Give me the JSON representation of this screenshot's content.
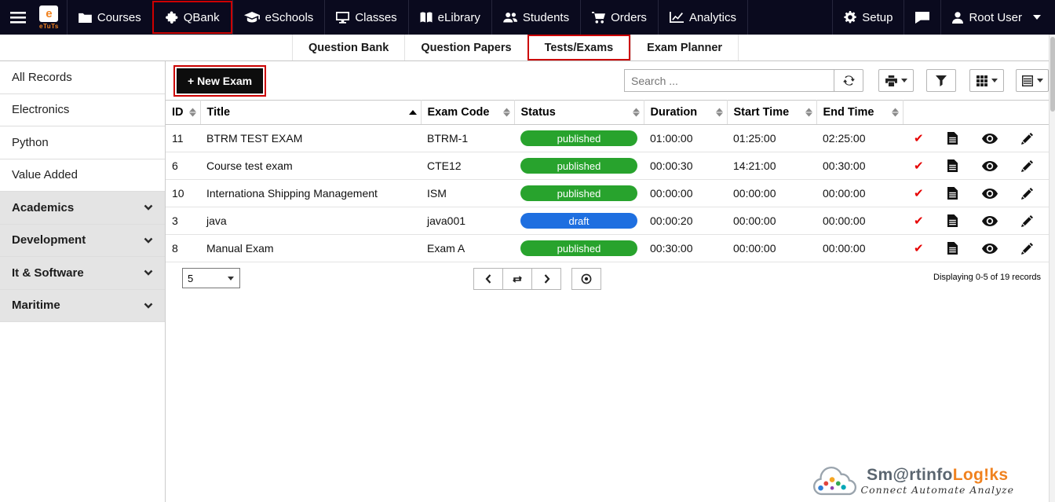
{
  "topbar": {
    "brand": {
      "logo_letter": "e",
      "name": "eTuTs"
    },
    "items": [
      {
        "label": "Courses",
        "icon": "folder"
      },
      {
        "label": "QBank",
        "icon": "puzzle",
        "active": true
      },
      {
        "label": "eSchools",
        "icon": "graduation-cap"
      },
      {
        "label": "Classes",
        "icon": "monitor"
      },
      {
        "label": "eLibrary",
        "icon": "book"
      },
      {
        "label": "Students",
        "icon": "users"
      },
      {
        "label": "Orders",
        "icon": "cart"
      },
      {
        "label": "Analytics",
        "icon": "line-chart"
      }
    ],
    "setup_label": "Setup",
    "user_label": "Root User"
  },
  "subnav": {
    "tabs": [
      {
        "label": "Question Bank"
      },
      {
        "label": "Question Papers"
      },
      {
        "label": "Tests/Exams",
        "active": true
      },
      {
        "label": "Exam Planner"
      }
    ]
  },
  "sidebar": {
    "items": [
      {
        "label": "All Records",
        "type": "link"
      },
      {
        "label": "Electronics",
        "type": "link"
      },
      {
        "label": "Python",
        "type": "link"
      },
      {
        "label": "Value Added",
        "type": "link"
      },
      {
        "label": "Academics",
        "type": "group"
      },
      {
        "label": "Development",
        "type": "group"
      },
      {
        "label": "It & Software",
        "type": "group"
      },
      {
        "label": "Maritime",
        "type": "group"
      }
    ]
  },
  "toolbar": {
    "new_exam_label": "+ New Exam",
    "search_placeholder": "Search ..."
  },
  "table": {
    "columns": [
      "ID",
      "Title",
      "Exam Code",
      "Status",
      "Duration",
      "Start Time",
      "End Time"
    ],
    "sort": {
      "column": "Title",
      "direction": "asc"
    },
    "rows": [
      {
        "id": "11",
        "title": "BTRM TEST EXAM",
        "code": "BTRM-1",
        "status": "published",
        "duration": "01:00:00",
        "start": "01:25:00",
        "end": "02:25:00"
      },
      {
        "id": "6",
        "title": "Course test exam",
        "code": "CTE12",
        "status": "published",
        "duration": "00:00:30",
        "start": "14:21:00",
        "end": "00:30:00"
      },
      {
        "id": "10",
        "title": "Internationa Shipping Management",
        "code": "ISM",
        "status": "published",
        "duration": "00:00:00",
        "start": "00:00:00",
        "end": "00:00:00"
      },
      {
        "id": "3",
        "title": "java",
        "code": "java001",
        "status": "draft",
        "duration": "00:00:20",
        "start": "00:00:00",
        "end": "00:00:00"
      },
      {
        "id": "8",
        "title": "Manual Exam",
        "code": "Exam A",
        "status": "published",
        "duration": "00:30:00",
        "start": "00:00:00",
        "end": "00:00:00"
      }
    ]
  },
  "pagination": {
    "page_size": "5",
    "summary": "Displaying 0-5 of 19 records"
  },
  "footer": {
    "brand_gray": "Sm@rtinfo",
    "brand_orange": "Log!ks",
    "tagline": "Connect Automate Analyze"
  },
  "icons": {
    "check": "✔"
  },
  "colors": {
    "published": "#28a32d",
    "draft": "#1e6fe0",
    "highlight": "#cc0000",
    "topbar_bg": "#0a0a1e",
    "brand_orange": "#f0821f"
  }
}
